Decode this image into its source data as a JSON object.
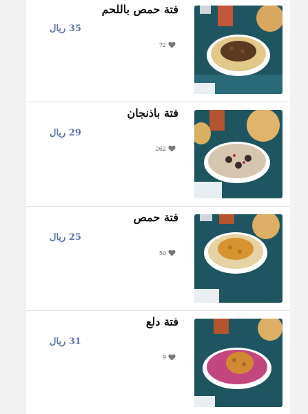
{
  "colors": {
    "price": "#5a72b0",
    "title": "#111111",
    "background": "#f2f2f2",
    "card": "#ffffff"
  },
  "items": [
    {
      "name": "فتة حمص باللحم",
      "price": "35 ريال",
      "likes": "72",
      "image": "fatteh-hummus-meat-photo",
      "icon": "heart-icon"
    },
    {
      "name": "فتة باذنجان",
      "price": "29 ريال",
      "likes": "262",
      "image": "fatteh-eggplant-photo",
      "icon": "heart-icon"
    },
    {
      "name": "فتة حمص",
      "price": "25 ريال",
      "likes": "50",
      "image": "fatteh-hummus-photo",
      "icon": "heart-icon"
    },
    {
      "name": "فتة دلع",
      "price": "31 ريال",
      "likes": "9",
      "image": "fatteh-dalaa-photo",
      "icon": "heart-icon"
    }
  ]
}
